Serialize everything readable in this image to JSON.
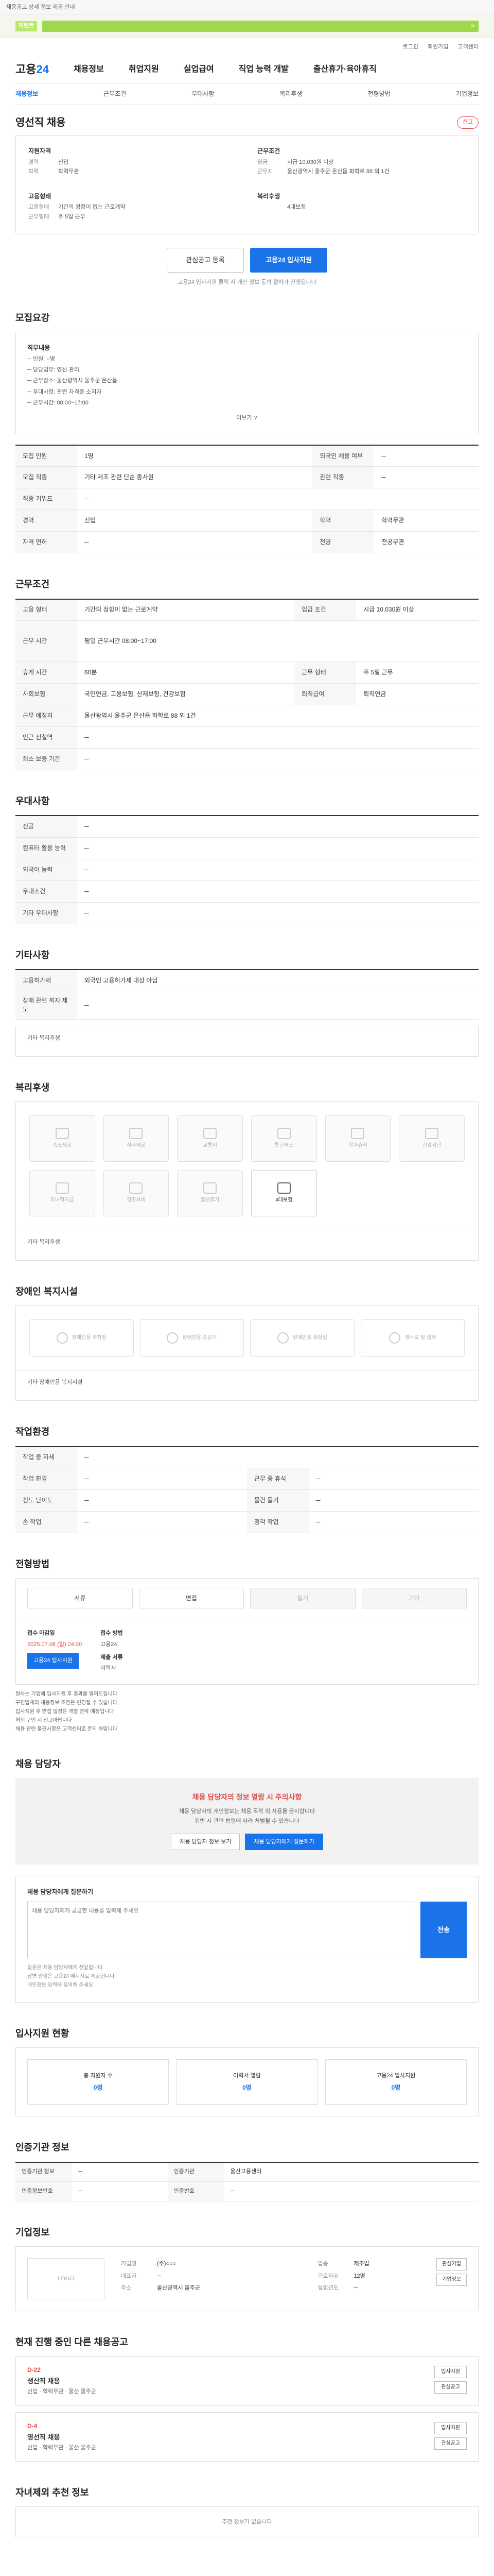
{
  "topnote": "채용공고 상세 정보 제공 안내",
  "banner": {
    "chip": "이벤트",
    "close": "×"
  },
  "util": [
    "로그인",
    "회원가입",
    "고객센터"
  ],
  "logo": {
    "a": "고용",
    "b": "24"
  },
  "gnb": [
    "채용정보",
    "취업지원",
    "실업급여",
    "직업 능력 개발",
    "출산휴가·육아휴직"
  ],
  "subtabs": [
    "채용정보",
    "근무조건",
    "우대사항",
    "복리후생",
    "전형방법",
    "기업정보"
  ],
  "title": "영선직 채용",
  "report": "신고",
  "summary": [
    {
      "label": "지원자격",
      "rows": [
        [
          "경력",
          "신입"
        ],
        [
          "학력",
          "학력무관"
        ]
      ]
    },
    {
      "label": "근무조건",
      "rows": [
        [
          "임금",
          "시급 10,030원 이상"
        ],
        [
          "근무지",
          "울산광역시 울주군 온산읍 화학로 88 외 1건"
        ]
      ]
    },
    {
      "label": "고용형태",
      "rows": [
        [
          "고용형태",
          "기간의 정함이 없는 근로계약"
        ],
        [
          "근무형태",
          "주 5일 근무"
        ]
      ]
    },
    {
      "label": "복리후생",
      "rows": [
        [
          "",
          "4대보험"
        ],
        [
          "",
          ""
        ]
      ]
    }
  ],
  "actions": {
    "scrap": "관심공고 등록",
    "apply": "고용24 입사지원"
  },
  "smallnote": "고용24 입사지원 클릭 시 개인 정보 동의 절차가 진행됩니다",
  "s_dept": {
    "title": "모집요강",
    "h": "직무내용",
    "lines": [
      "─ 인원: ○명",
      "─ 담당업무: 영선 관리",
      "─ 근무장소: 울산광역시 울주군 온산읍",
      "─ 우대사항: 관련 자격증 소지자",
      "─ 근무시간: 08:00~17:00"
    ],
    "more": "더보기 ∨"
  },
  "t1": [
    [
      "모집 인원",
      "1명",
      "외국인 채용 여부",
      "─"
    ],
    [
      "모집 직종",
      "기타 제조 관련 단순 종사원",
      "관련 직종",
      "─"
    ],
    [
      "직종 키워드",
      "─",
      "",
      ""
    ],
    [
      "경력",
      "신입",
      "학력",
      "학력무관"
    ],
    [
      "자격 면허",
      "─",
      "전공",
      "전공무관"
    ]
  ],
  "s_cond": {
    "title": "근무조건"
  },
  "t2": [
    [
      "고용 형태",
      "기간의 정함이 없는 근로계약",
      "임금 조건",
      "시급 10,030원 이상"
    ],
    [
      "근무 시간",
      "평일 근무시간 08:00~17:00",
      "",
      ""
    ],
    [
      "휴게 시간",
      "60분",
      "근무 형태",
      "주 5일 근무"
    ],
    [
      "사회보험",
      "국민연금, 고용보험, 산재보험, 건강보험",
      "퇴직급여",
      "퇴직연금"
    ],
    [
      "근무 예정지",
      "울산광역시 울주군 온산읍 화학로 88 외 1건",
      "",
      ""
    ],
    [
      "인근 전철역",
      "─",
      "",
      ""
    ],
    [
      "최소 보증 기간",
      "─",
      "",
      ""
    ]
  ],
  "s_pref": {
    "title": "우대사항"
  },
  "t3": [
    [
      "전공",
      "─"
    ],
    [
      "컴퓨터 활용 능력",
      "─"
    ],
    [
      "외국어 능력",
      "─"
    ],
    [
      "우대조건",
      "─"
    ],
    [
      "기타 우대사항",
      "─"
    ]
  ],
  "s_etc": {
    "title": "기타사항"
  },
  "t4": [
    [
      "고용허가제",
      "외국인 고용허가제 대상 아님"
    ],
    [
      "장애 관련 복지 제도",
      "─"
    ]
  ],
  "etc_note": "기타 복리후생",
  "s_welfare": {
    "title": "복리후생",
    "items": [
      "숙소제공",
      "식사제공",
      "교통비",
      "통근버스",
      "육아휴직",
      "건강검진",
      "자녀학자금",
      "경조사비",
      "출산휴가",
      "4대보험",
      "",
      ""
    ]
  },
  "welf_note": "기타 복리후생",
  "s_dis": {
    "title": "장애인 복지시설",
    "items": [
      "장애인용 주차장",
      "장애인용 승강기",
      "장애인용 화장실",
      "경사로 및 점자"
    ]
  },
  "dis_note": "기타 장애인용 복지시설",
  "s_work": {
    "title": "작업환경"
  },
  "t5": [
    [
      "작업 중 자세",
      "─",
      "",
      ""
    ],
    [
      "작업 환경",
      "─",
      "근무 중 휴식",
      "─"
    ],
    [
      "정도 난이도",
      "─",
      "물건 들기",
      "─"
    ],
    [
      "손 작업",
      "─",
      "청각 작업",
      "─"
    ]
  ],
  "s_sel": {
    "title": "전형방법",
    "methods": [
      "서류",
      "면접",
      "필기",
      "기타"
    ]
  },
  "apply": {
    "c1t": "접수 마감일",
    "c1v": "2025.07.06 (일) 24:00",
    "c2t": "접수 방법",
    "c2v": "고용24",
    "c3t": "제출 서류",
    "c3v": "이력서",
    "btn": "고용24 입사지원"
  },
  "bullets": [
    "원하는 기업에 입사지원 후 결과를 알려드립니다",
    "구인업체의 채용정보 조건은 변경될 수 있습니다",
    "입사지원 후 면접 일정은 개별 연락 예정입니다",
    "허위 구인 시 신고바랍니다",
    "채용 관련 불편사항은 고객센터로 문의 바랍니다"
  ],
  "s_mgr": {
    "title": "채용 담당자",
    "alert": "채용 담당자의 정보 열람 시 주의사항",
    "p1": "채용 담당자의 개인정보는 채용 목적 외 사용을 금지합니다",
    "p2": "위반 시 관련 법령에 따라 처벌될 수 있습니다",
    "b1": "채용 담당자 정보 보기",
    "b2": "채용 담당자에게 질문하기"
  },
  "qa": {
    "t": "채용 담당자에게 질문하기",
    "ph": "채용 담당자에게 궁금한 내용을 입력해 주세요",
    "send": "전송",
    "notes": [
      "질문은 채용 담당자에게 전달됩니다",
      "답변 알림은 고용24 메시지로 제공됩니다",
      "개인정보 입력에 유의해 주세요"
    ]
  },
  "s_stat": {
    "title": "입사지원 현황",
    "items": [
      [
        "총 지원자 수",
        "0명"
      ],
      [
        "이력서 열람",
        "0명"
      ],
      [
        "고용24 입사지원",
        "0명"
      ]
    ]
  },
  "s_info": {
    "title": "인증기관 정보"
  },
  "t6": [
    [
      "인증기관 정보",
      "─",
      "인증기관",
      "울산고용센터"
    ],
    [
      "인증정보번호",
      "─",
      "인증번호",
      "─"
    ]
  ],
  "s_comp": {
    "title": "기업정보",
    "logo": "LOGO",
    "rows": [
      [
        "기업명",
        "(주)○○○",
        "업종",
        "제조업"
      ],
      [
        "대표자",
        "─",
        "근로자수",
        "12명"
      ],
      [
        "주소",
        "울산광역시 울주군",
        "설립년도",
        "─"
      ]
    ],
    "side": [
      "관심기업",
      "기업정보"
    ]
  },
  "s_jobs": {
    "title": "현재 진행 중인 다른 채용공고",
    "list": [
      {
        "d": "D-22",
        "n": "생산직 채용",
        "meta": "신입 · 학력무관 · 울산 울주군",
        "r": [
          "입사지원",
          "관심공고"
        ]
      },
      {
        "d": "D-4",
        "n": "영선직 채용",
        "meta": "신입 · 학력무관 · 울산 울주군",
        "r": [
          "입사지원",
          "관심공고"
        ]
      }
    ]
  },
  "s_cert": {
    "title": "자녀제외 추천 정보",
    "empty": "추천 정보가 없습니다"
  }
}
